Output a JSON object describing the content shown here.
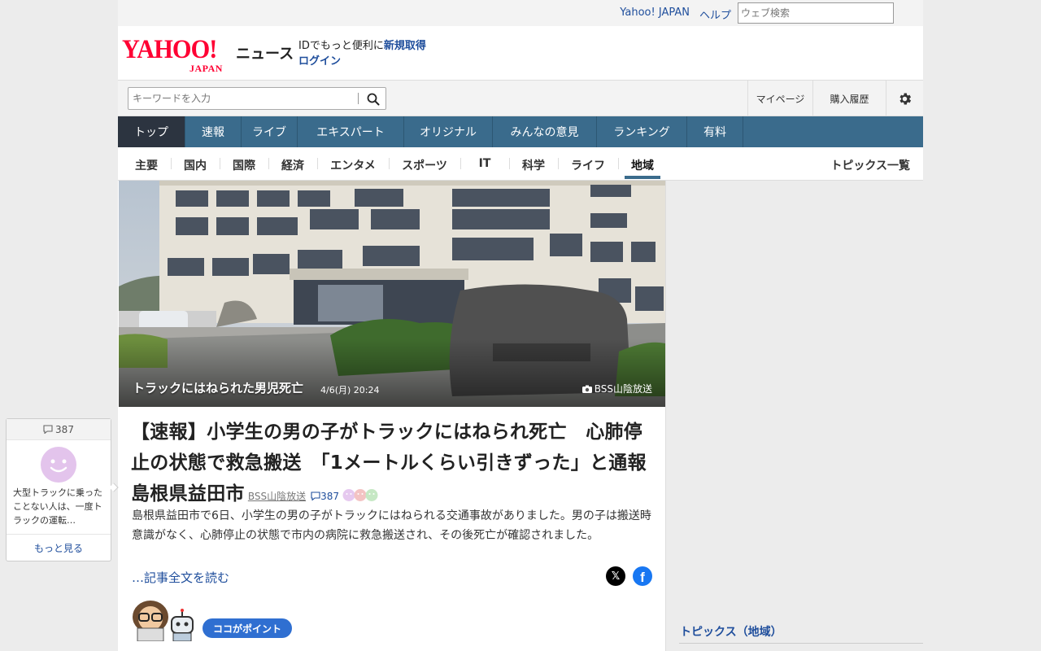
{
  "topbar": {
    "links": [
      "Yahoo! JAPAN",
      "ヘルプ"
    ],
    "web_search_placeholder": "ウェブ検索"
  },
  "header": {
    "logo_text": "YAHOO!",
    "logo_sub": "JAPAN",
    "site_name": "ニュース",
    "login_prompt": "IDでもっと便利に",
    "signup": "新規取得",
    "login": "ログイン"
  },
  "search": {
    "placeholder": "キーワードを入力",
    "mypage": "マイページ",
    "purchase_history": "購入履歴"
  },
  "nav": {
    "items": [
      "トップ",
      "速報",
      "ライブ",
      "エキスパート",
      "オリジナル",
      "みんなの意見",
      "ランキング",
      "有料"
    ],
    "active": "トップ"
  },
  "subnav": {
    "items": [
      "主要",
      "国内",
      "国際",
      "経済",
      "エンタメ",
      "スポーツ",
      "IT",
      "科学",
      "ライフ",
      "地域"
    ],
    "active": "地域",
    "topics_list": "トピックス一覧"
  },
  "article": {
    "photo_caption": "トラックにはねられた男児死亡",
    "photo_date": "4/6(月) 20:24",
    "photo_credit": "BSS山陰放送",
    "headline": "【速報】小学生の男の子がトラックにはねられ死亡　心肺停止の状態で救急搬送　「1メートルくらい引きずった」と通報　島根県益田市",
    "source": "BSS山陰放送",
    "comment_count": "387",
    "lead": "島根県益田市で6日、小学生の男の子がトラックにはねられる交通事故がありました。男の子は搬送時意識がなく、心肺停止の状態で市内の病院に救急搬送され、その後死亡が確認されました。",
    "read_more": "…記事全文を読む",
    "point_badge": "ココがポイント"
  },
  "comment_box": {
    "count": "387",
    "snippet": "大型トラックに乗ったことない人は、一度トラックの運転…",
    "more": "もっと見る"
  },
  "right": {
    "topics_title": "トピックス（地域）"
  },
  "colors": {
    "brand_red": "#ff0033",
    "nav_blue": "#3a6b8c",
    "nav_active": "#2c3440",
    "link_blue": "#1f4e9c"
  }
}
